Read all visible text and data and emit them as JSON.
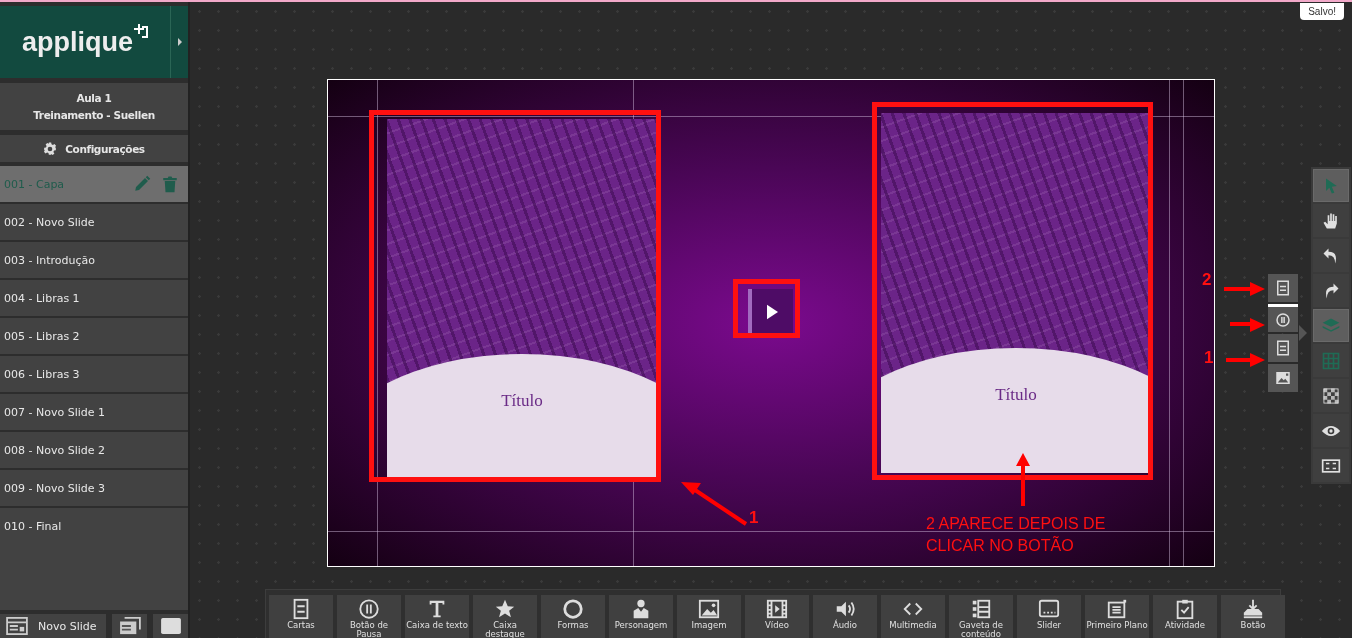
{
  "app": {
    "logo": "applique",
    "saved_badge": "Salvo!"
  },
  "course": {
    "title": "Aula 1",
    "subtitle": "Treinamento - Suellen"
  },
  "settings_button": "Configurações",
  "slides": [
    {
      "label": "001 - Capa",
      "selected": true
    },
    {
      "label": "002 - Novo Slide",
      "selected": false
    },
    {
      "label": "003 - Introdução",
      "selected": false
    },
    {
      "label": "004 - Libras 1",
      "selected": false
    },
    {
      "label": "005 - Libras 2",
      "selected": false
    },
    {
      "label": "006 - Libras 3",
      "selected": false
    },
    {
      "label": "007 - Novo Slide 1",
      "selected": false
    },
    {
      "label": "008 - Novo Slide 2",
      "selected": false
    },
    {
      "label": "009 - Novo Slide 3",
      "selected": false
    },
    {
      "label": "010 - Final",
      "selected": false
    }
  ],
  "sidebar_footer": {
    "new_slide": "Novo Slide"
  },
  "canvas": {
    "cards": [
      {
        "title": "Título"
      },
      {
        "title": "Título"
      }
    ]
  },
  "layer_panel": [
    {
      "kind": "card",
      "selected": false
    },
    {
      "kind": "pause",
      "selected": true
    },
    {
      "kind": "card",
      "selected": false
    },
    {
      "kind": "image",
      "selected": false
    }
  ],
  "tools": [
    {
      "kind": "pointer",
      "selected": true,
      "on": true
    },
    {
      "kind": "hand",
      "selected": false,
      "on": false
    },
    {
      "kind": "undo",
      "selected": false,
      "on": false
    },
    {
      "kind": "redo",
      "selected": false,
      "on": false
    },
    {
      "kind": "layers",
      "selected": true,
      "on": true
    },
    {
      "kind": "grid",
      "selected": false,
      "on": true
    },
    {
      "kind": "checker",
      "selected": false,
      "on": false
    },
    {
      "kind": "eye",
      "selected": false,
      "on": false
    },
    {
      "kind": "frame",
      "selected": false,
      "on": false
    }
  ],
  "components": [
    {
      "kind": "cards",
      "label": "Cartas"
    },
    {
      "kind": "pause",
      "label": "Botão de Pausa"
    },
    {
      "kind": "text",
      "label": "Caixa de texto"
    },
    {
      "kind": "star",
      "label": "Caixa destaque"
    },
    {
      "kind": "shapes",
      "label": "Formas"
    },
    {
      "kind": "character",
      "label": "Personagem"
    },
    {
      "kind": "image",
      "label": "Imagem"
    },
    {
      "kind": "video",
      "label": "Vídeo"
    },
    {
      "kind": "audio",
      "label": "Áudio"
    },
    {
      "kind": "code",
      "label": "Multimedia"
    },
    {
      "kind": "drawer",
      "label": "Gaveta de conteúdo"
    },
    {
      "kind": "slider",
      "label": "Slider"
    },
    {
      "kind": "foreground",
      "label": "Primeiro Plano"
    },
    {
      "kind": "activity",
      "label": "Atividade"
    },
    {
      "kind": "button",
      "label": "Botão"
    }
  ],
  "annotations": {
    "note": "2 APARECE DEPOIS DE CLICAR NO BOTÃO",
    "numbers": [
      "1",
      "2",
      "1"
    ]
  }
}
